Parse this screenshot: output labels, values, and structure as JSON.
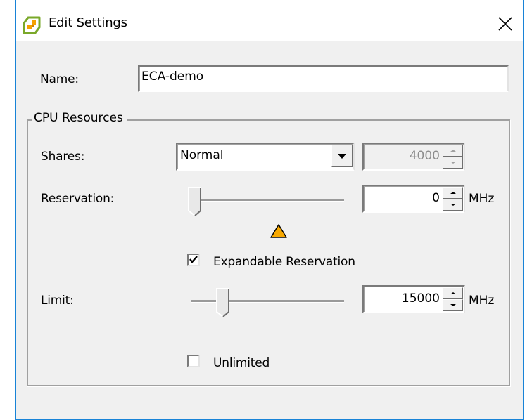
{
  "window": {
    "title": "Edit Settings",
    "icons": {
      "app": "vsphere-app-icon",
      "close": "close-icon"
    }
  },
  "name_field": {
    "label": "Name:",
    "value": "ECA-demo"
  },
  "cpu_resources": {
    "title": "CPU Resources",
    "shares": {
      "label": "Shares:",
      "selected": "Normal",
      "value": "4000",
      "value_enabled": false
    },
    "reservation": {
      "label": "Reservation:",
      "value": "0",
      "unit": "MHz",
      "slider_fraction": 0.0,
      "warning_icon": "warning-triangle-icon"
    },
    "expandable_reservation": {
      "label": "Expandable Reservation",
      "checked": true
    },
    "limit": {
      "label": "Limit:",
      "value": "15000",
      "unit": "MHz",
      "slider_fraction": 0.2
    },
    "unlimited": {
      "label": "Unlimited",
      "checked": false
    }
  },
  "colors": {
    "window_border": "#1883d7",
    "dialog_bg": "#f0f0f0",
    "warning": "#f7a800"
  }
}
